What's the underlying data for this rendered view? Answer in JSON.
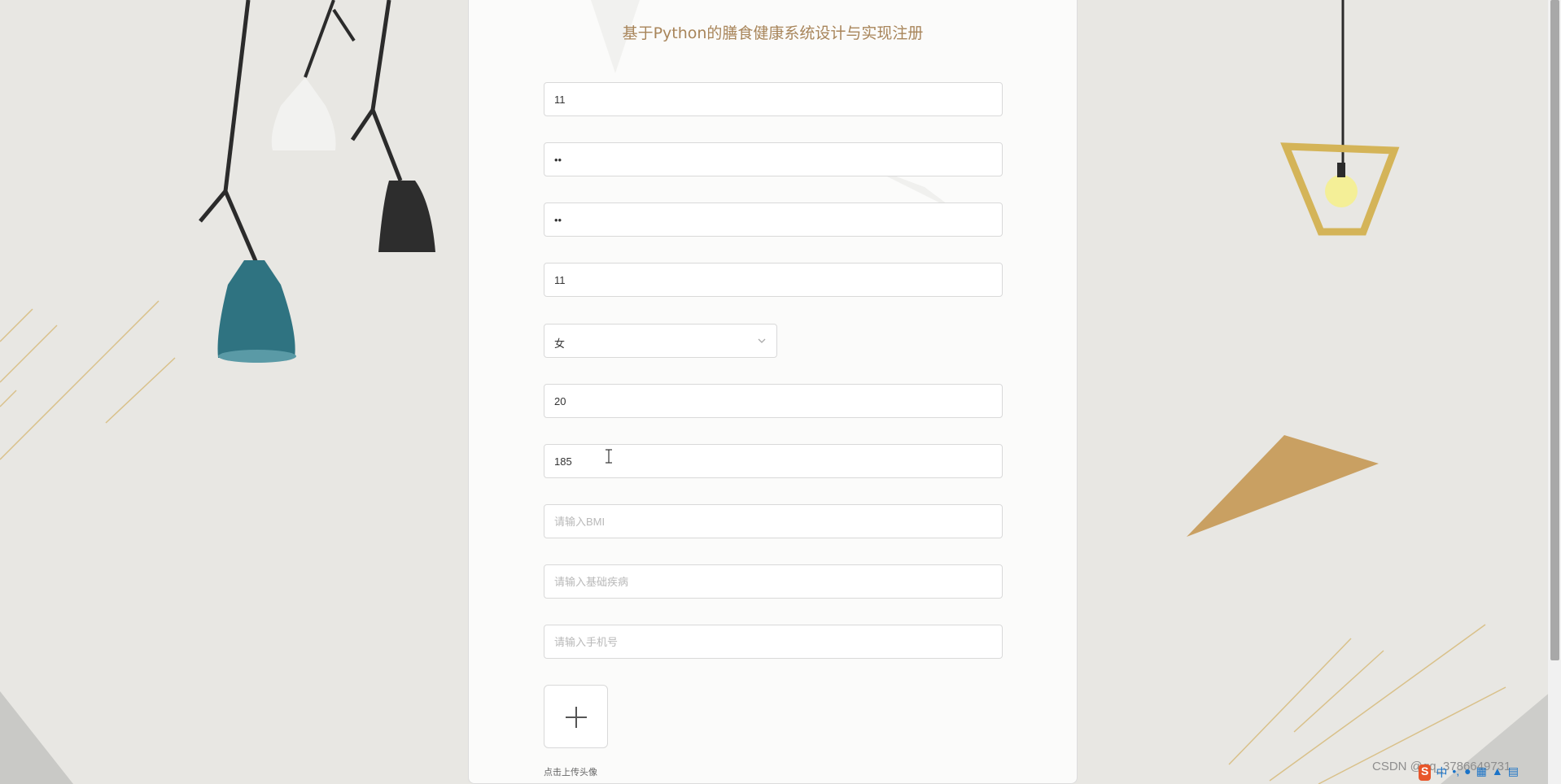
{
  "form": {
    "title": "基于Python的膳食健康系统设计与实现注册",
    "fields": [
      {
        "value": "11",
        "placeholder": ""
      },
      {
        "value": "••",
        "placeholder": ""
      },
      {
        "value": "••",
        "placeholder": ""
      },
      {
        "value": "11",
        "placeholder": ""
      },
      {
        "value": "20",
        "placeholder": ""
      },
      {
        "value": "185",
        "placeholder": ""
      },
      {
        "value": "",
        "placeholder": "请输入BMI"
      },
      {
        "value": "",
        "placeholder": "请输入基础疾病"
      },
      {
        "value": "",
        "placeholder": "请输入手机号"
      }
    ],
    "gender": {
      "selected": "女"
    },
    "upload": {
      "hint": "点击上传头像"
    }
  },
  "overlay": {
    "watermark": "CSDN @qq_3786649731",
    "tray_icons": [
      "input-method-logo",
      "中",
      "•,",
      "mic",
      "keyboard",
      "shirt",
      "grid"
    ]
  }
}
